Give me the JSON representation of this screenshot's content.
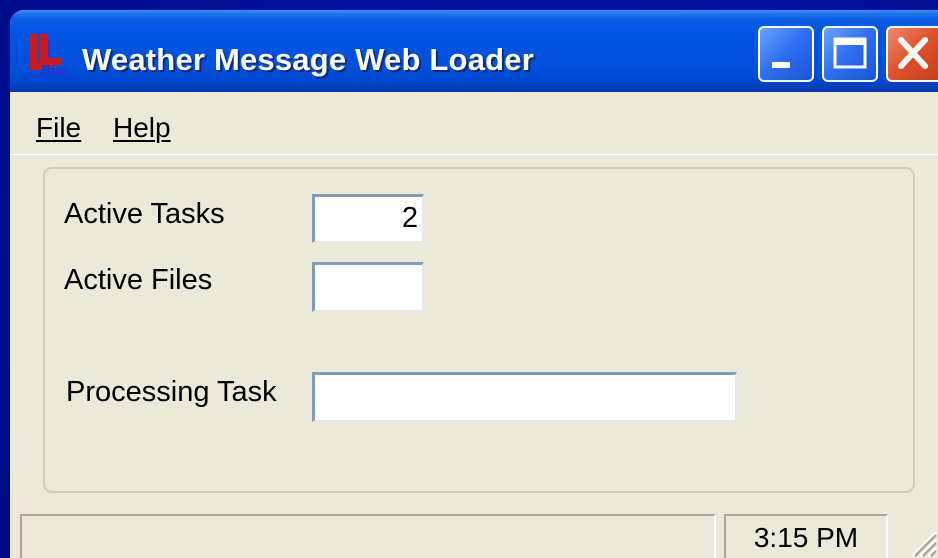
{
  "window": {
    "title": "Weather Message Web Loader",
    "app_icon": "app-logo-icon",
    "controls": {
      "minimize_icon": "minimize-icon",
      "maximize_icon": "maximize-icon",
      "close_icon": "close-icon"
    }
  },
  "menu": {
    "file": "File",
    "help": "Help"
  },
  "fields": {
    "active_tasks": {
      "label": "Active Tasks",
      "value": "2"
    },
    "active_files": {
      "label": "Active Files",
      "value": ""
    },
    "processing_task": {
      "label": "Processing Task",
      "value": ""
    }
  },
  "status": {
    "main": "",
    "time": "3:15 PM"
  },
  "colors": {
    "title_bar": "#0054e3",
    "window_face": "#ece9d8",
    "close_button": "#e0502a",
    "desktop": "#0010a0"
  }
}
